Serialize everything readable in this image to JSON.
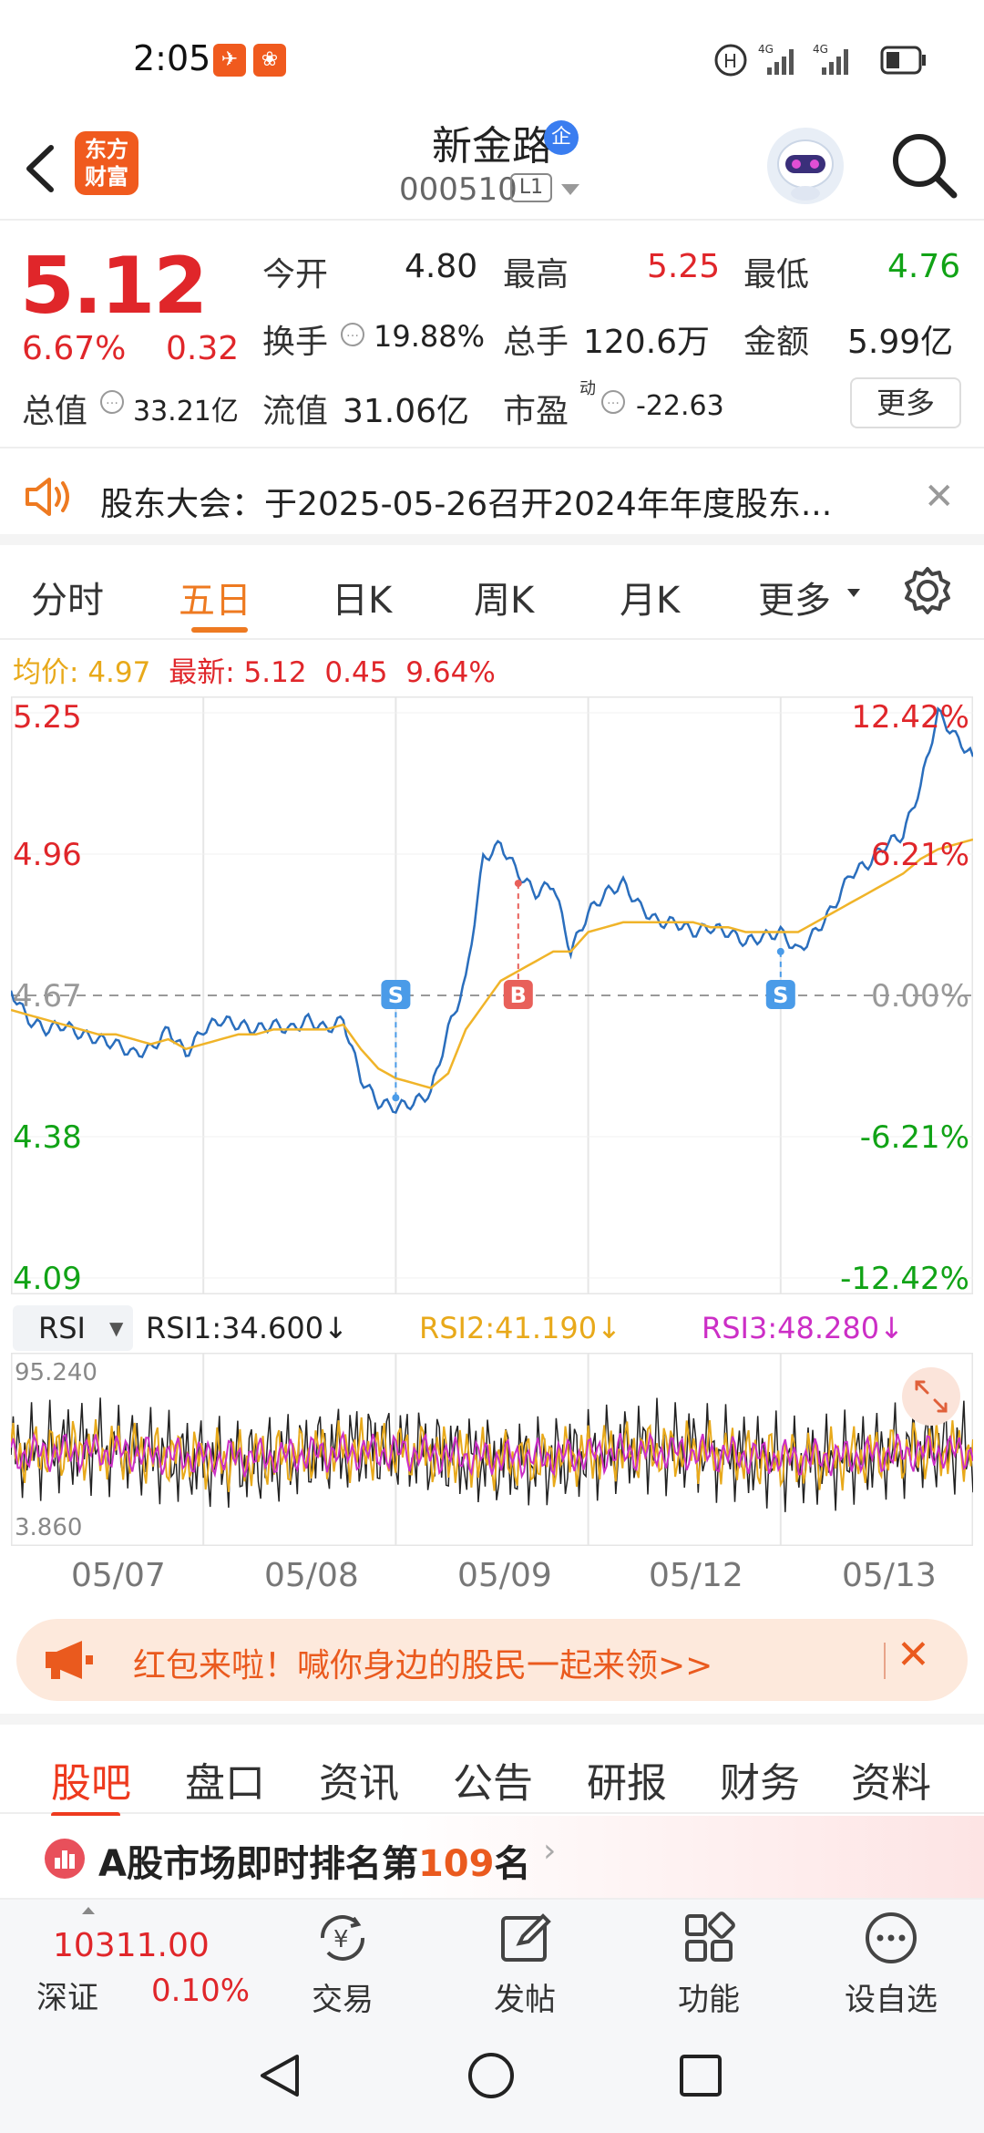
{
  "status_bar": {
    "time": "2:05"
  },
  "header": {
    "stock_name": "新金路",
    "corp_badge": "企",
    "stock_code": "000510",
    "level_badge": "L1",
    "logo_text_line1": "东方",
    "logo_text_line2": "财富"
  },
  "quote": {
    "price": "5.12",
    "change_pct": "6.67%",
    "change_amt": "0.32",
    "open_label": "今开",
    "open": "4.80",
    "high_label": "最高",
    "high": "5.25",
    "low_label": "最低",
    "low": "4.76",
    "turnover_label": "换手",
    "turnover": "19.88%",
    "volume_label": "总手",
    "volume": "120.6万",
    "amount_label": "金额",
    "amount": "5.99亿",
    "market_cap_label": "总值",
    "market_cap": "33.21亿",
    "float_cap_label": "流值",
    "float_cap": "31.06亿",
    "pe_label": "市盈",
    "pe_sup": "动",
    "pe": "-22.63",
    "more_button": "更多"
  },
  "notice": {
    "text": "股东大会：于2025-05-26召开2024年年度股东..."
  },
  "chart_tabs": [
    "分时",
    "五日",
    "日K",
    "周K",
    "月K",
    "更多"
  ],
  "active_chart_tab": "五日",
  "summary": {
    "avg_label": "均价:",
    "avg": "4.97",
    "latest_label": "最新:",
    "latest": "5.12",
    "chg": "0.45",
    "chg_pct": "9.64%"
  },
  "chart_data": {
    "type": "line",
    "y_labels_left": [
      "5.25",
      "4.96",
      "4.67",
      "4.38",
      "4.09"
    ],
    "y_labels_right": [
      "12.42%",
      "6.21%",
      "0.00%",
      "-6.21%",
      "-12.42%"
    ],
    "ylim": [
      4.09,
      5.25
    ],
    "reference": 4.67,
    "x_dates": [
      "05/07",
      "05/08",
      "05/09",
      "05/12",
      "05/13"
    ],
    "series": [
      {
        "values": [
          4.68,
          4.62,
          4.6,
          4.61,
          4.59,
          4.58,
          4.57,
          4.55,
          4.56,
          4.6,
          4.55,
          4.6,
          4.62,
          4.61,
          4.6,
          4.61,
          4.6,
          4.62,
          4.6,
          4.62,
          4.5,
          4.45,
          4.44,
          4.45,
          4.47,
          4.6,
          4.7,
          4.95,
          4.98,
          4.92,
          4.88,
          4.9,
          4.76,
          4.84,
          4.88,
          4.9,
          4.85,
          4.82,
          4.82,
          4.8,
          4.81,
          4.8,
          4.78,
          4.79,
          4.8,
          4.76,
          4.8,
          4.85,
          4.92,
          4.94,
          4.98,
          5.0,
          5.1,
          5.25,
          5.2,
          5.16
        ]
      },
      {
        "values": [
          4.64,
          4.63,
          4.62,
          4.61,
          4.6,
          4.59,
          4.59,
          4.58,
          4.57,
          4.58,
          4.56,
          4.57,
          4.58,
          4.59,
          4.59,
          4.6,
          4.6,
          4.6,
          4.6,
          4.61,
          4.56,
          4.52,
          4.5,
          4.49,
          4.48,
          4.51,
          4.6,
          4.65,
          4.7,
          4.72,
          4.74,
          4.76,
          4.76,
          4.8,
          4.81,
          4.82,
          4.82,
          4.82,
          4.82,
          4.82,
          4.81,
          4.81,
          4.8,
          4.8,
          4.8,
          4.8,
          4.82,
          4.84,
          4.86,
          4.88,
          4.9,
          4.92,
          4.95,
          4.97,
          4.98,
          4.99
        ]
      }
    ],
    "markers": [
      {
        "label": "S",
        "x_index": 22,
        "y": 4.46
      },
      {
        "label": "B",
        "x_index": 29,
        "y": 4.9
      },
      {
        "label": "S",
        "x_index": 44,
        "y": 4.76
      }
    ]
  },
  "rsi": {
    "selector": "RSI",
    "rsi1": "RSI1:34.600",
    "rsi2": "RSI2:41.190",
    "rsi3": "RSI3:48.280",
    "max": "95.240",
    "min": "3.860"
  },
  "red_packet": {
    "text": "红包来啦！喊你身边的股民一起来领>>"
  },
  "bottom_tabs": [
    "股吧",
    "盘口",
    "资讯",
    "公告",
    "研报",
    "财务",
    "资料"
  ],
  "ranking": {
    "prefix": "A股市场即时排名第",
    "rank": "109",
    "suffix": "名"
  },
  "index": {
    "value": "10311.00",
    "name": "深证",
    "pct": "0.10%"
  },
  "nav": [
    "交易",
    "发帖",
    "功能",
    "设自选"
  ],
  "colors": {
    "up": "#e0262a",
    "down": "#11a316",
    "accent": "#ee7a21",
    "price_line": "#2a6ebd",
    "avg_line": "#f0b429"
  }
}
